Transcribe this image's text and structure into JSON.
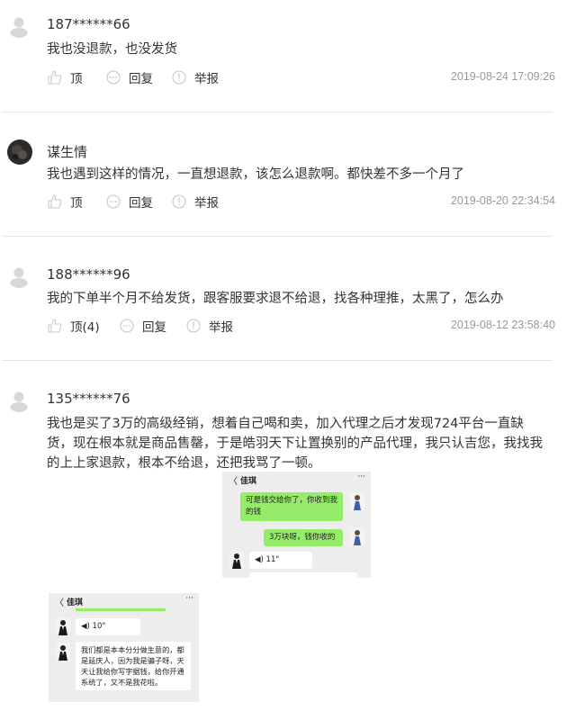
{
  "comments": [
    {
      "username": "187******66",
      "text": "我也没退款，也没发货",
      "like_label": "顶",
      "reply_label": "回复",
      "report_label": "举报",
      "timestamp": "2019-08-24 17:09:26"
    },
    {
      "username": "谋生情",
      "text": "我也遇到这样的情况，一直想退款，该怎么退款啊。都快差不多一个月了",
      "like_label": "顶",
      "reply_label": "回复",
      "report_label": "举报",
      "timestamp": "2019-08-20 22:34:54"
    },
    {
      "username": "188******96",
      "text": "我的下单半个月不给发货，跟客服要求退不给退，找各种理推，太黑了，怎么办",
      "like_label": "顶(4)",
      "reply_label": "回复",
      "report_label": "举报",
      "timestamp": "2019-08-12 23:58:40"
    },
    {
      "username": "135******76",
      "text": "我也是买了3万的高级经销，想着自己喝和卖，加入代理之后才发现724平台一直缺货，现在根本就是商品售罄，于是皓羽天下让置换别的产品代理，我只认吉您，我找我的上上家退款，根本不给退，还把我骂了一顿。"
    }
  ],
  "chat1": {
    "contact_name": "佳琪",
    "back_glyph": "〈",
    "more_glyph": "···",
    "messages": [
      "可是钱交给你了，你收到我的钱",
      "3万块呀，钱你收的"
    ],
    "voice": "◀) 11\""
  },
  "chat2": {
    "contact_name": "佳琪",
    "back_glyph": "〈",
    "more_glyph": "···",
    "voice": "◀) 10\"",
    "message": "我们都是本本分分做生意的，都是延庆人，因为我是骗子呀，天天让我给你写字据钱，给你开通系统了，又不是我花啦。"
  },
  "icons": {
    "like": "thumbs-up-icon",
    "reply": "chat-bubble-icon",
    "report": "warning-icon"
  },
  "colors": {
    "text": "#333333",
    "timestamp": "#999999",
    "divider": "#e4e4e4",
    "wechat_green": "#95ec69"
  }
}
